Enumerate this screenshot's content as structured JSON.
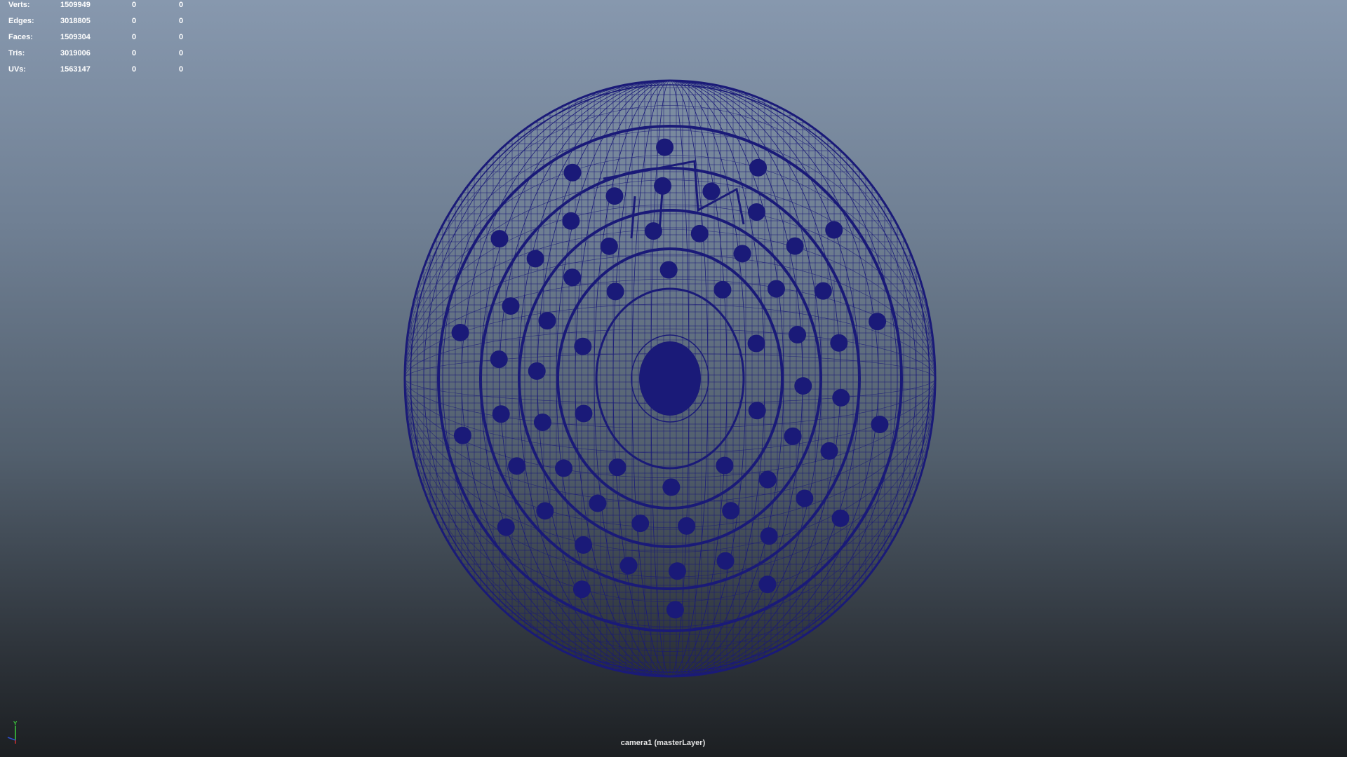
{
  "hud": {
    "rows": [
      {
        "label": "Verts:",
        "total": "1509949",
        "selected": "0",
        "component": "0"
      },
      {
        "label": "Edges:",
        "total": "3018805",
        "selected": "0",
        "component": "0"
      },
      {
        "label": "Faces:",
        "total": "1509304",
        "selected": "0",
        "component": "0"
      },
      {
        "label": "Tris:",
        "total": "3019006",
        "selected": "0",
        "component": "0"
      },
      {
        "label": "UVs:",
        "total": "1563147",
        "selected": "0",
        "component": "0"
      }
    ]
  },
  "viewport": {
    "camera_label": "camera1 (masterLayer)",
    "wire_color": "#1a1a78",
    "background_top": "#8798ae",
    "background_bottom": "#1c1f22"
  },
  "axis_gizmo": {
    "y_label": "Y",
    "y_color": "#3ccc3c",
    "x_color": "#d03030",
    "z_color": "#3050d0"
  }
}
